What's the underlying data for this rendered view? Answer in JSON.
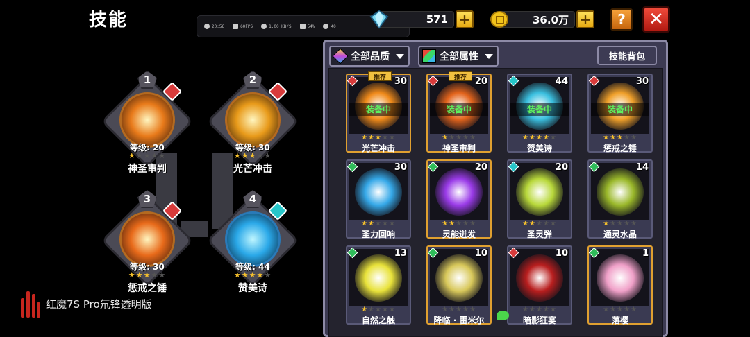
{
  "page_title": "技能",
  "overlay": {
    "time": "20:56",
    "fps": "60FPS",
    "net": "1.00 KB/S",
    "battery": "54%",
    "temp": "40"
  },
  "resources": {
    "gems": "571",
    "gold": "36.0万"
  },
  "buttons": {
    "help": "?",
    "close": "✕",
    "plus": "+"
  },
  "slots": [
    {
      "num": "1",
      "level": "等级: 20",
      "stars": 1,
      "name": "神圣审判",
      "element": "fire"
    },
    {
      "num": "2",
      "level": "等级: 30",
      "stars": 3,
      "name": "光芒冲击",
      "element": "fire"
    },
    {
      "num": "3",
      "level": "等级: 30",
      "stars": 3,
      "name": "惩戒之锤",
      "element": "fire"
    },
    {
      "num": "4",
      "level": "等级: 44",
      "stars": 4,
      "name": "赞美诗",
      "element": "ice"
    }
  ],
  "filters": {
    "quality": "全部品质",
    "attribute": "全部属性",
    "bag": "技能背包"
  },
  "equipped_label": "装备中",
  "recommended_label": "推荐",
  "skills": [
    {
      "name": "光芒冲击",
      "level": "30",
      "stars": 3,
      "equipped": true,
      "recommended": true,
      "element": "fire",
      "frame": "orange",
      "art": "#f08a1a"
    },
    {
      "name": "神圣审判",
      "level": "20",
      "stars": 1,
      "equipped": true,
      "recommended": true,
      "element": "fire",
      "frame": "orange",
      "art": "#e3641c"
    },
    {
      "name": "赞美诗",
      "level": "44",
      "stars": 4,
      "equipped": true,
      "recommended": false,
      "element": "ice",
      "frame": "purple",
      "art": "#3bc0e0"
    },
    {
      "name": "惩戒之锤",
      "level": "30",
      "stars": 3,
      "equipped": true,
      "recommended": false,
      "element": "fire",
      "frame": "purple",
      "art": "#f0a02a"
    },
    {
      "name": "圣力回响",
      "level": "30",
      "stars": 2,
      "equipped": false,
      "recommended": false,
      "element": "nature",
      "frame": "purple",
      "art": "#35a8e8"
    },
    {
      "name": "灵能迸发",
      "level": "20",
      "stars": 2,
      "equipped": false,
      "recommended": false,
      "element": "nature",
      "frame": "orange",
      "art": "#9a3be8"
    },
    {
      "name": "圣灵弹",
      "level": "20",
      "stars": 2,
      "equipped": false,
      "recommended": false,
      "element": "ice",
      "frame": "purple",
      "art": "#b8d83a"
    },
    {
      "name": "通灵水晶",
      "level": "14",
      "stars": 1,
      "equipped": false,
      "recommended": false,
      "element": "nature",
      "frame": "purple",
      "art": "#9ab82a"
    },
    {
      "name": "自然之触",
      "level": "13",
      "stars": 1,
      "equipped": false,
      "recommended": false,
      "element": "nature",
      "frame": "purple",
      "art": "#e8e23a"
    },
    {
      "name": "降临 · 雷米尔",
      "level": "10",
      "stars": 0,
      "equipped": false,
      "recommended": false,
      "element": "nature",
      "frame": "orange",
      "art": "#d8c85a"
    },
    {
      "name": "暗影狂宴",
      "level": "10",
      "stars": 0,
      "equipped": false,
      "recommended": false,
      "element": "fire",
      "frame": "purple",
      "art": "#b81e1e"
    },
    {
      "name": "落樱",
      "level": "1",
      "stars": 0,
      "equipped": false,
      "recommended": false,
      "element": "nature",
      "frame": "orange",
      "art": "#f0a0c8"
    }
  ],
  "brand": "红魔7S Pro氘锋透明版",
  "colors": {
    "fire": "#d83b3b",
    "ice": "#27c6c9",
    "nature": "#2fbd5a",
    "star_on": "#f6c12d",
    "star_off": "#555555",
    "equipped": "#5df05d"
  }
}
